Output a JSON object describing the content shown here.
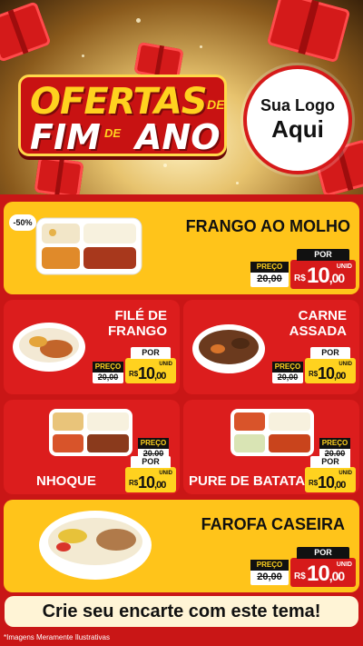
{
  "header": {
    "title_top": "OFERTAS",
    "title_de_small": "DE",
    "title_bottom_left": "FIM",
    "title_de_small2": "DE",
    "title_bottom_right": "ANO",
    "logo_line1": "Sua Logo",
    "logo_line2": "Aqui"
  },
  "badge": "-50%",
  "price_labels": {
    "old": "PREÇO",
    "new": "POR",
    "currency": "R$",
    "unit": "UNID"
  },
  "products": [
    {
      "name": "FRANGO AO MOLHO",
      "old_price": "20,00",
      "price_int": "10",
      "price_cents": ",00"
    },
    {
      "name": "FILÉ DE FRANGO",
      "old_price": "20,00",
      "price_int": "10",
      "price_cents": ",00"
    },
    {
      "name": "CARNE ASSADA",
      "old_price": "20,00",
      "price_int": "10",
      "price_cents": ",00"
    },
    {
      "name": "NHOQUE",
      "old_price": "20,00",
      "price_int": "10",
      "price_cents": ",00"
    },
    {
      "name": "PURE DE BATATA",
      "old_price": "20,00",
      "price_int": "10",
      "price_cents": ",00"
    },
    {
      "name": "FAROFA CASEIRA",
      "old_price": "20,00",
      "price_int": "10",
      "price_cents": ",00"
    }
  ],
  "footer": {
    "cta": "Crie seu encarte com este tema!",
    "disclaimer": "*Imagens Meramente Ilustrativas"
  },
  "colors": {
    "brand_red": "#c91616",
    "card_yellow": "#ffc41a",
    "price_yellow": "#ffd21f"
  }
}
